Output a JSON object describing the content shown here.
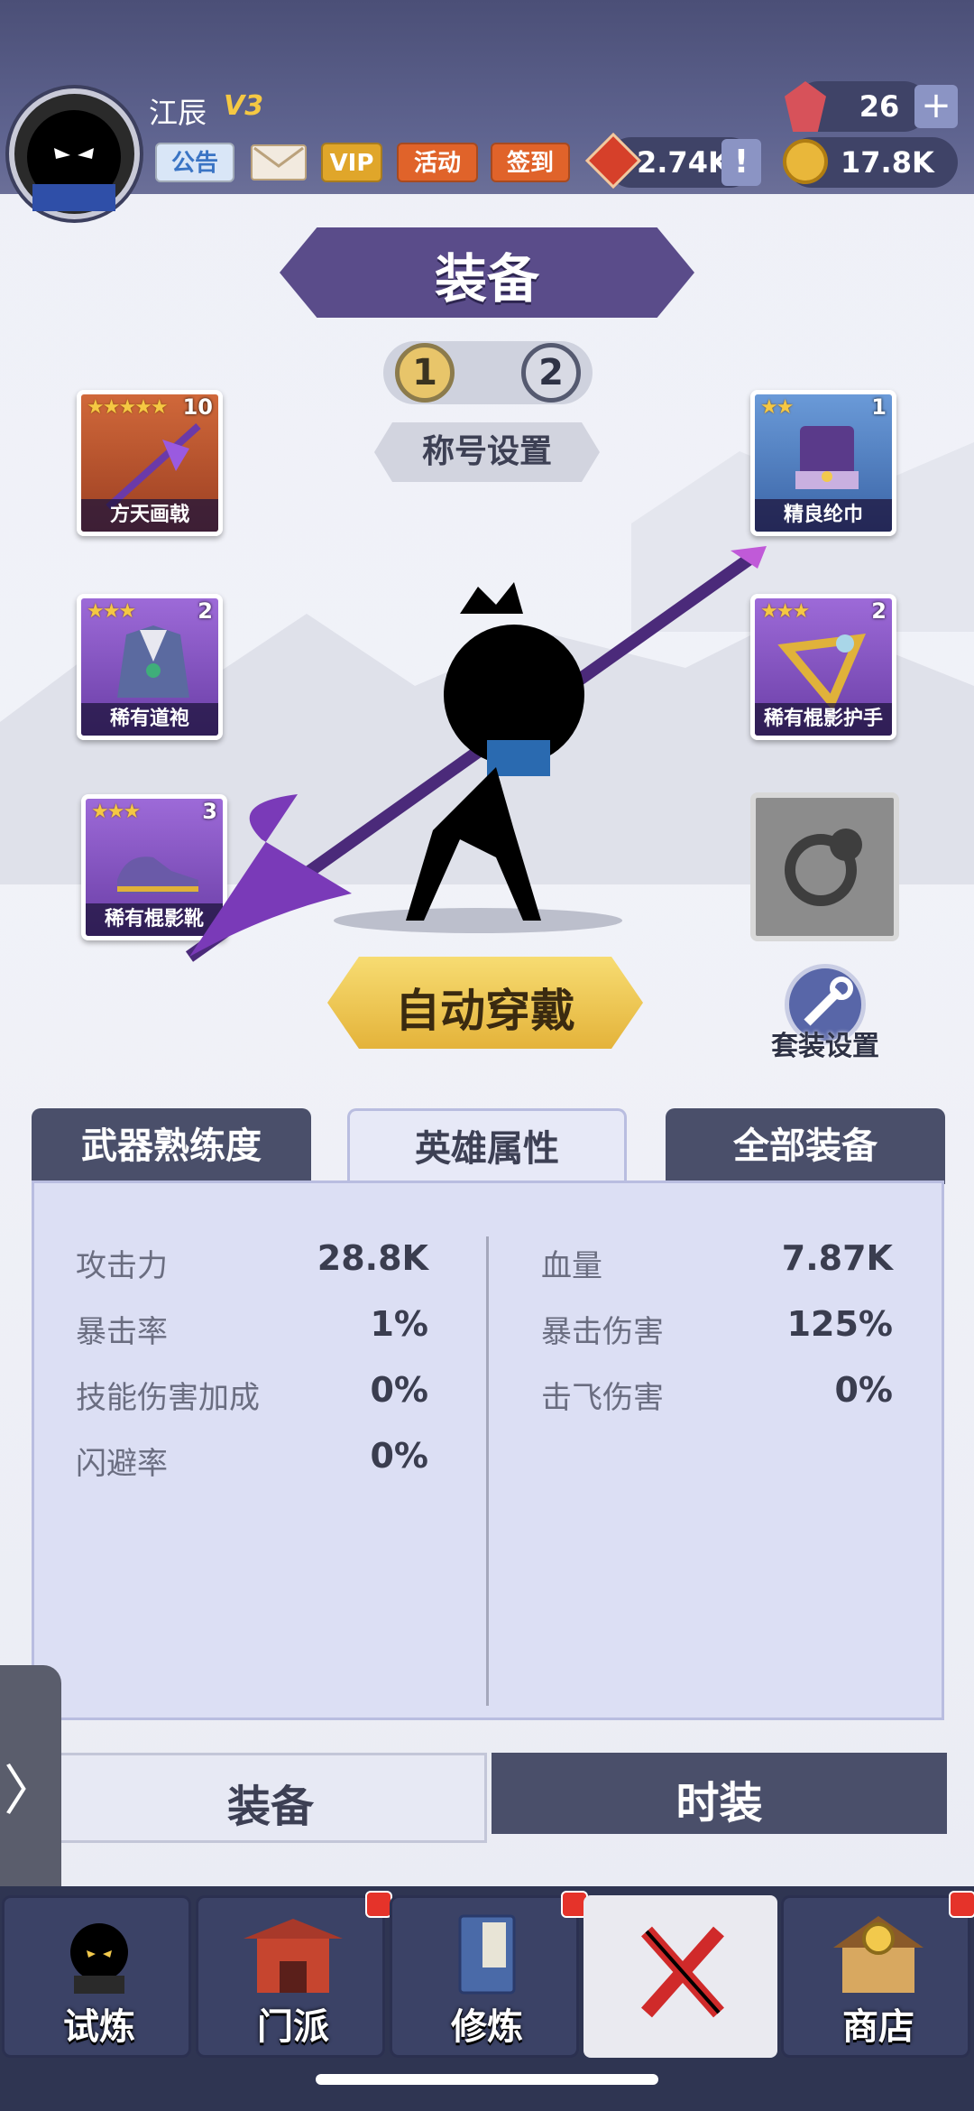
{
  "header": {
    "player_name": "江辰",
    "vip_level": "V3",
    "buttons": [
      "公告",
      "VIP",
      "活动",
      "签到"
    ],
    "gems": "26",
    "honor": "2.74K",
    "coins": "17.8K"
  },
  "equipment": {
    "title": "装备",
    "loadouts": [
      "1",
      "2"
    ],
    "title_setting": "称号设置",
    "slots": [
      {
        "name": "方天画戟",
        "stars": "★★★★★",
        "level": "10"
      },
      {
        "name": "稀有道袍",
        "stars": "★★★",
        "level": "2"
      },
      {
        "name": "稀有棍影靴",
        "stars": "★★★",
        "level": "3"
      },
      {
        "name": "精良纶巾",
        "stars": "★★",
        "level": "1"
      },
      {
        "name": "稀有棍影护手",
        "stars": "★★★",
        "level": "2"
      }
    ],
    "auto_equip": "自动穿戴",
    "set_setting": "套装设置"
  },
  "tabs": [
    "武器熟练度",
    "英雄属性",
    "全部装备"
  ],
  "stats_left": [
    {
      "label": "攻击力",
      "value": "28.8K"
    },
    {
      "label": "暴击率",
      "value": "1%"
    },
    {
      "label": "技能伤害加成",
      "value": "0%"
    },
    {
      "label": "闪避率",
      "value": "0%"
    }
  ],
  "stats_right": [
    {
      "label": "血量",
      "value": "7.87K"
    },
    {
      "label": "暴击伤害",
      "value": "125%"
    },
    {
      "label": "击飞伤害",
      "value": "0%"
    }
  ],
  "bottom_tabs": [
    "装备",
    "时装"
  ],
  "side_arrow": "〉",
  "nav": [
    "试炼",
    "门派",
    "修炼",
    "商店"
  ],
  "colors": {
    "accent_purple": "#5a4c8a",
    "gold": "#f2c94c",
    "nav_bg": "#3b4266"
  }
}
